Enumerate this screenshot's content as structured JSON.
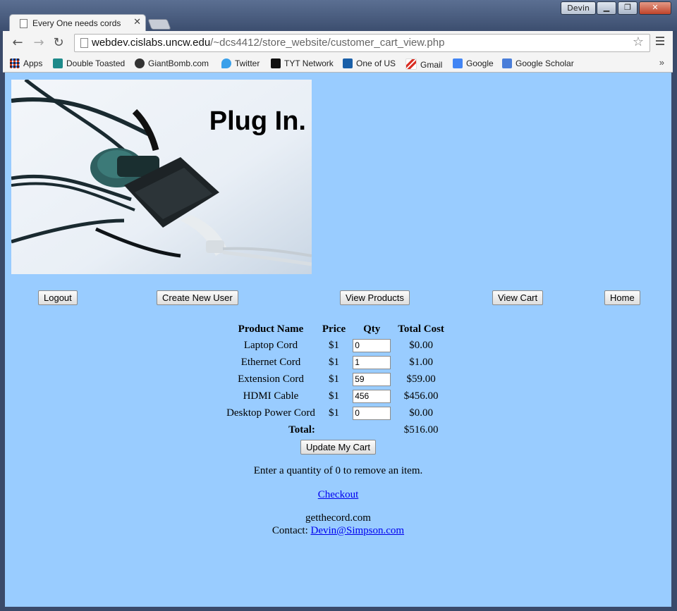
{
  "window": {
    "user": "Devin",
    "tab_title": "Every One needs cords"
  },
  "browser": {
    "url_host": "webdev.cislabs.uncw.edu",
    "url_path": "/~dcs4412/store_website/customer_cart_view.php",
    "bookmarks": [
      {
        "label": "Apps",
        "icon": "apps-grid-icon",
        "color": "#e0452b"
      },
      {
        "label": "Double Toasted",
        "icon": "double-toasted-icon",
        "color": "#1e8a8a"
      },
      {
        "label": "GiantBomb.com",
        "icon": "giantbomb-icon",
        "color": "#333333"
      },
      {
        "label": "Twitter",
        "icon": "twitter-bird-icon",
        "color": "#3aa0ea"
      },
      {
        "label": "TYT Network",
        "icon": "tyt-icon",
        "color": "#111111"
      },
      {
        "label": "One of US",
        "icon": "one-of-us-icon",
        "color": "#1a5fa8"
      },
      {
        "label": "Gmail",
        "icon": "gmail-icon",
        "color": "#d93025"
      },
      {
        "label": "Google",
        "icon": "google-icon",
        "color": "#4285f4"
      },
      {
        "label": "Google Scholar",
        "icon": "google-scholar-icon",
        "color": "#4a7ed9"
      }
    ],
    "more": "»"
  },
  "hero": {
    "title": "Plug In."
  },
  "nav": {
    "logout": "Logout",
    "create_user": "Create New User",
    "view_products": "View Products",
    "view_cart": "View Cart",
    "home": "Home"
  },
  "cart": {
    "headers": {
      "product": "Product Name",
      "price": "Price",
      "qty": "Qty",
      "total": "Total Cost"
    },
    "rows": [
      {
        "name": "Laptop Cord",
        "price": "$1",
        "qty": "0",
        "total": "$0.00"
      },
      {
        "name": "Ethernet Cord",
        "price": "$1",
        "qty": "1",
        "total": "$1.00"
      },
      {
        "name": "Extension Cord",
        "price": "$1",
        "qty": "59",
        "total": "$59.00"
      },
      {
        "name": "HDMI Cable",
        "price": "$1",
        "qty": "456",
        "total": "$456.00"
      },
      {
        "name": "Desktop Power Cord",
        "price": "$1",
        "qty": "0",
        "total": "$0.00"
      }
    ],
    "total_label": "Total:",
    "total_value": "$516.00",
    "update_button": "Update My Cart",
    "note": "Enter a quantity of 0 to remove an item.",
    "checkout_link": "Checkout"
  },
  "footer": {
    "site": "getthecord.com",
    "contact_label": "Contact:",
    "contact_email": "Devin@Simpson.com"
  },
  "colors": {
    "page_background": "#99ccff",
    "link": "#0000ee"
  }
}
